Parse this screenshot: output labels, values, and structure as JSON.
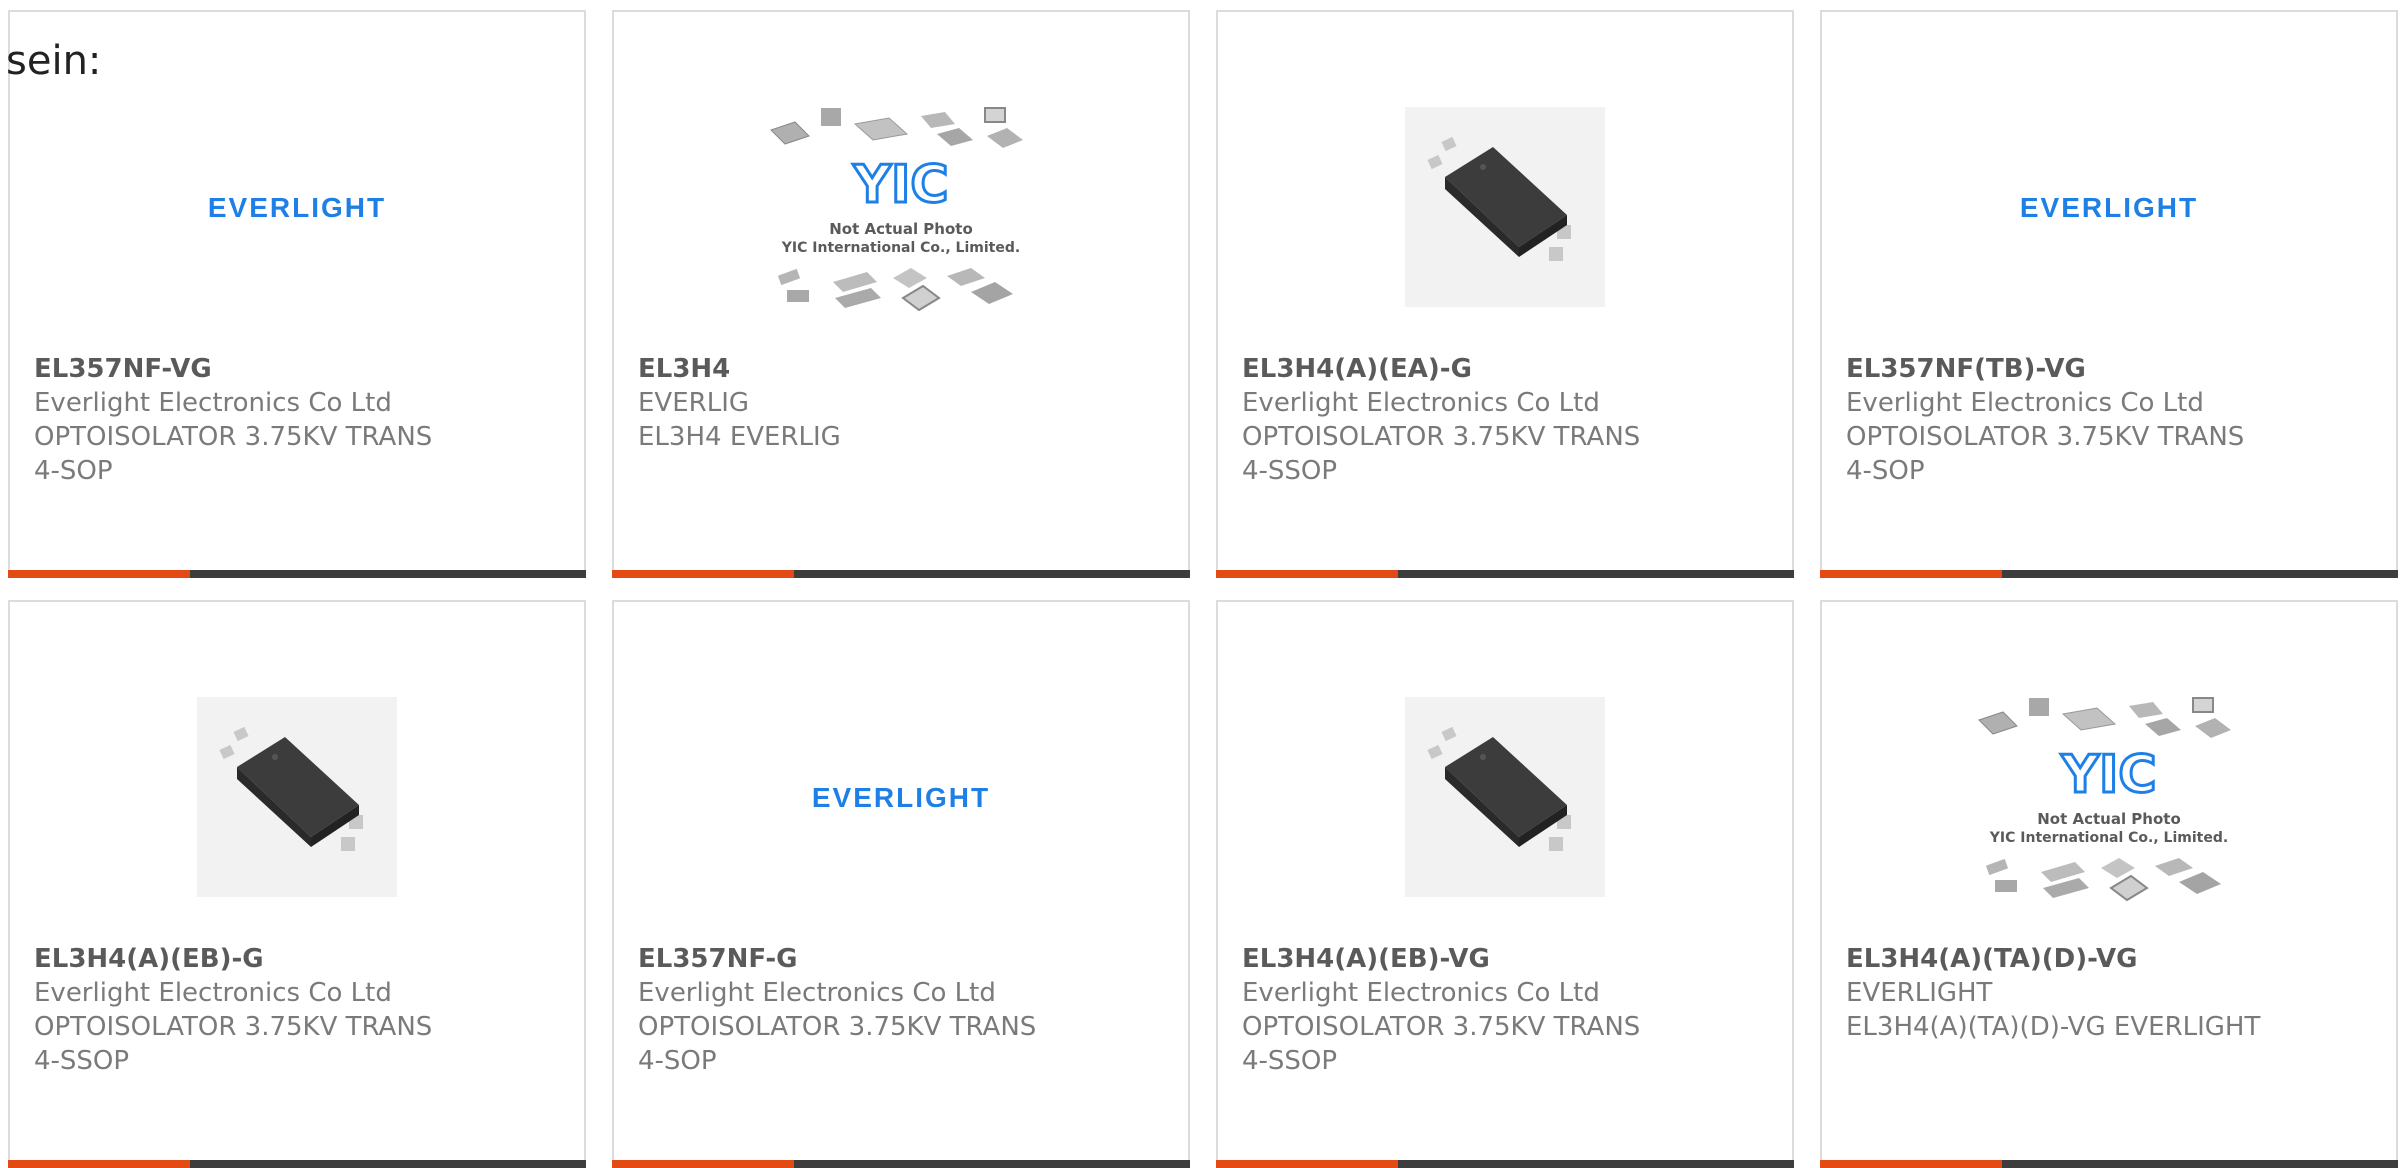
{
  "lead_text": "sein:",
  "colors": {
    "brand_blue": "#1e7fe6",
    "accent_orange": "#e34a14",
    "bar_dark": "#3d3d3d",
    "card_border": "#dcdcdc"
  },
  "image_labels": {
    "everlight": "EVERLIGHT",
    "yic_mark": "YIC",
    "yic_line1": "Not Actual Photo",
    "yic_line2": "YIC International Co., Limited."
  },
  "products": [
    {
      "image": "everlight-logo",
      "part": "EL357NF-VG",
      "lines": [
        "Everlight Electronics Co Ltd",
        "OPTOISOLATOR 3.75KV TRANS",
        "4-SOP"
      ]
    },
    {
      "image": "yic-placeholder",
      "part": "EL3H4",
      "lines": [
        "EVERLIG",
        "EL3H4 EVERLIG",
        ""
      ]
    },
    {
      "image": "chip-photo",
      "part": "EL3H4(A)(EA)-G",
      "lines": [
        "Everlight Electronics Co Ltd",
        "OPTOISOLATOR 3.75KV TRANS",
        "4-SSOP"
      ]
    },
    {
      "image": "everlight-logo",
      "part": "EL357NF(TB)-VG",
      "lines": [
        "Everlight Electronics Co Ltd",
        "OPTOISOLATOR 3.75KV TRANS",
        "4-SOP"
      ]
    },
    {
      "image": "chip-photo",
      "part": "EL3H4(A)(EB)-G",
      "lines": [
        "Everlight Electronics Co Ltd",
        "OPTOISOLATOR 3.75KV TRANS",
        "4-SSOP"
      ]
    },
    {
      "image": "everlight-logo",
      "part": "EL357NF-G",
      "lines": [
        "Everlight Electronics Co Ltd",
        "OPTOISOLATOR 3.75KV TRANS",
        "4-SOP"
      ]
    },
    {
      "image": "chip-photo",
      "part": "EL3H4(A)(EB)-VG",
      "lines": [
        "Everlight Electronics Co Ltd",
        "OPTOISOLATOR 3.75KV TRANS",
        "4-SSOP"
      ]
    },
    {
      "image": "yic-placeholder",
      "part": "EL3H4(A)(TA)(D)-VG",
      "lines": [
        "EVERLIGHT",
        "EL3H4(A)(TA)(D)-VG EVERLIGHT",
        ""
      ]
    }
  ]
}
